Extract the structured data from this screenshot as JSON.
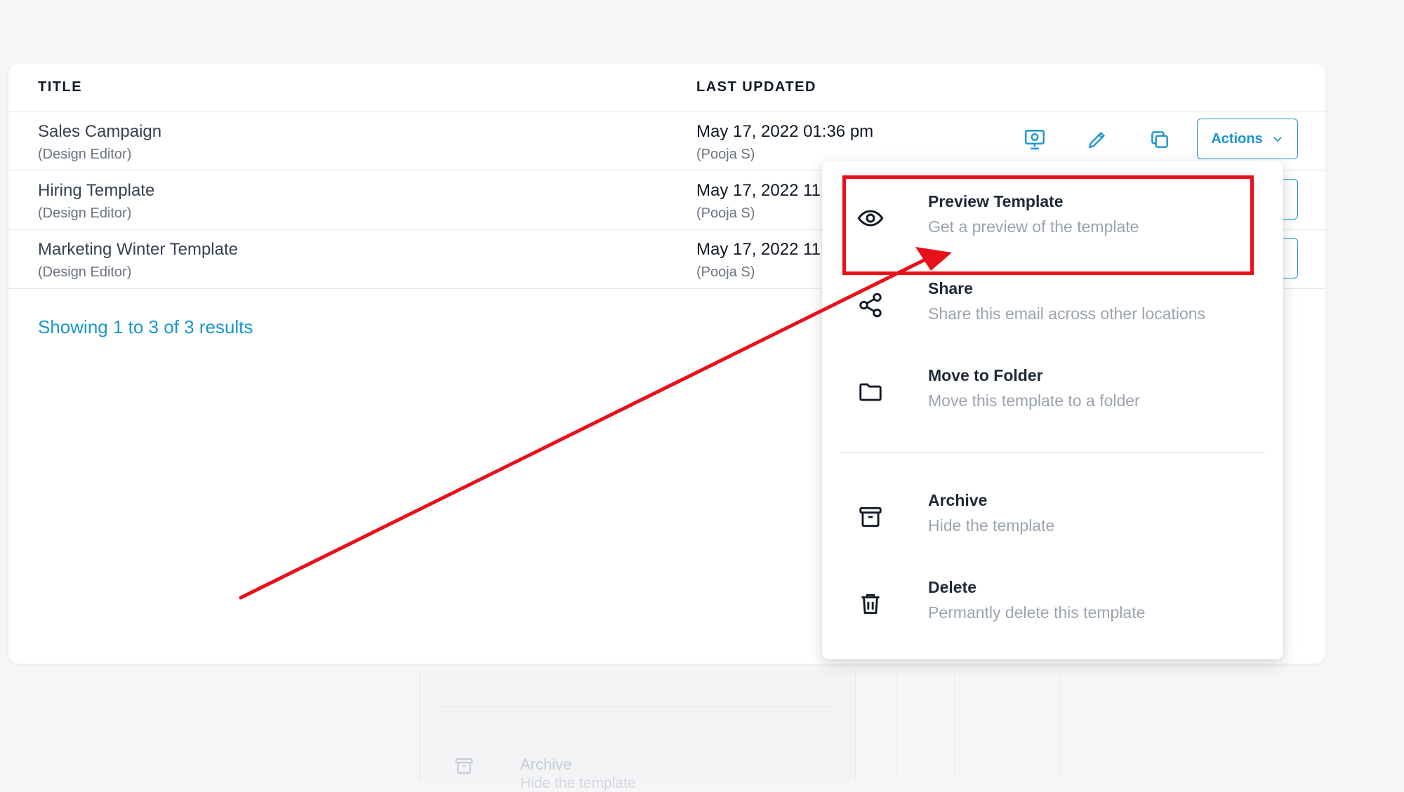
{
  "table": {
    "headers": {
      "title": "TITLE",
      "last_updated": "LAST UPDATED"
    },
    "rows": [
      {
        "title": "Sales Campaign",
        "type": "(Design Editor)",
        "date": "May 17, 2022 01:36 pm",
        "user": "(Pooja S)"
      },
      {
        "title": "Hiring Template",
        "type": "(Design Editor)",
        "date": "May 17, 2022 11",
        "user": "(Pooja S)"
      },
      {
        "title": "Marketing Winter Template",
        "type": "(Design Editor)",
        "date": "May 17, 2022 11",
        "user": "(Pooja S)"
      }
    ],
    "actions_label": "Actions",
    "results_text": "Showing 1 to 3 of 3 results"
  },
  "dropdown": {
    "items": [
      {
        "title": "Preview Template",
        "desc": "Get a preview of the template",
        "icon": "eye-icon"
      },
      {
        "title": "Share",
        "desc": "Share this email across other locations",
        "icon": "share-icon"
      },
      {
        "title": "Move to Folder",
        "desc": "Move this template to a folder",
        "icon": "folder-icon"
      },
      {
        "title": "Archive",
        "desc": "Hide the template",
        "icon": "archive-icon"
      },
      {
        "title": "Delete",
        "desc": "Permantly delete this template",
        "icon": "trash-icon"
      }
    ]
  },
  "background_menu": {
    "archive_title": "Archive",
    "archive_desc": "Hide the template"
  },
  "colors": {
    "accent": "#1a95cf",
    "annotation": "#e8101a",
    "muted_text": "#9ca3af"
  }
}
